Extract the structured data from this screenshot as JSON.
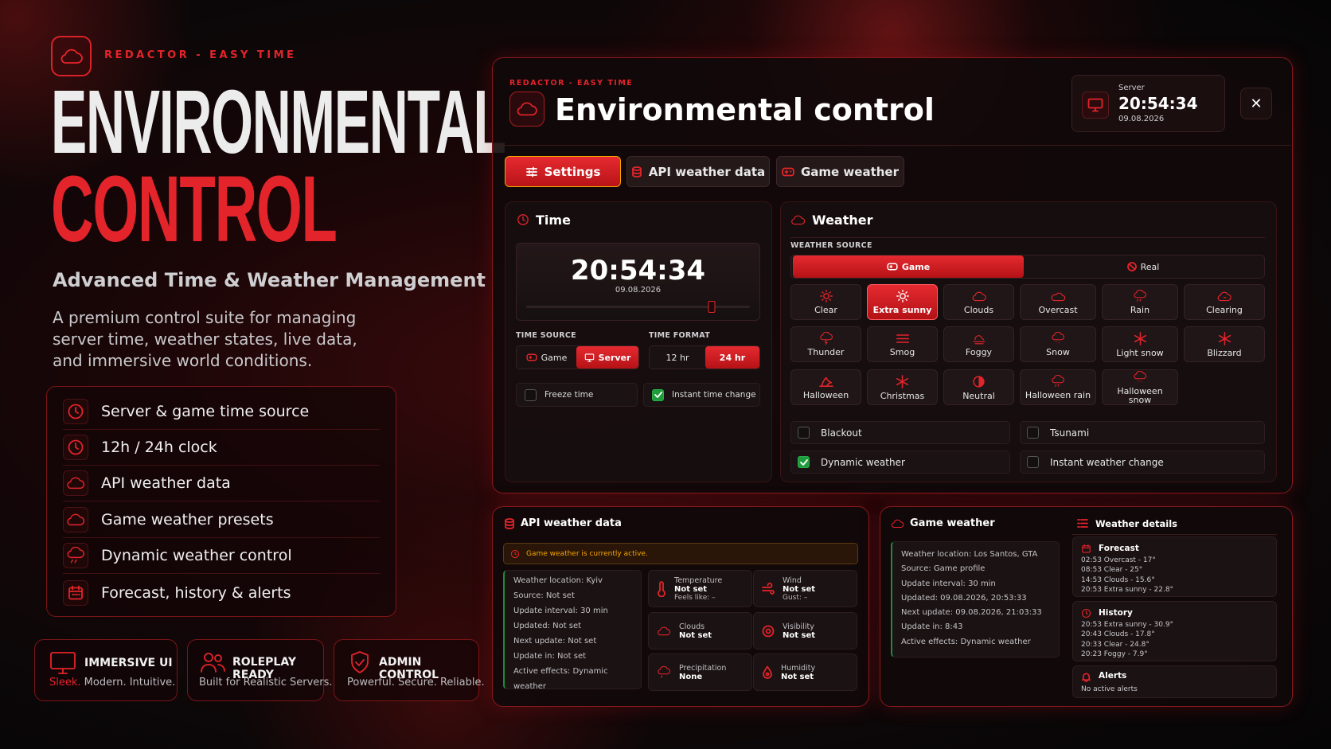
{
  "brand": {
    "tag": "REDACTOR - EASY TIME"
  },
  "hero": {
    "title_line1": "ENVIRONMENTAL",
    "title_line2": "CONTROL",
    "subtitle": "Advanced Time & Weather Management",
    "description": "A premium control suite for managing server time, weather states, live data, and immersive world conditions."
  },
  "features": [
    {
      "icon": "clock-icon",
      "label": "Server & game time source"
    },
    {
      "icon": "clock-icon",
      "label": "12h / 24h clock"
    },
    {
      "icon": "cloud-icon",
      "label": "API weather data"
    },
    {
      "icon": "cloud-icon",
      "label": "Game weather presets"
    },
    {
      "icon": "cloud-rain-icon",
      "label": "Dynamic weather control"
    },
    {
      "icon": "calendar-icon",
      "label": "Forecast, history & alerts"
    }
  ],
  "tiles": [
    {
      "title": "IMMERSIVE UI",
      "sub_accent": "Sleek.",
      "sub": "Modern. Intuitive."
    },
    {
      "title": "ROLEPLAY READY",
      "sub": "Built for Realistic Servers."
    },
    {
      "title": "ADMIN CONTROL",
      "sub": "Powerful. Secure. Reliable."
    }
  ],
  "panel": {
    "tag": "REDACTOR - EASY TIME",
    "title": "Environmental control",
    "server": {
      "label": "Server",
      "time": "20:54:34",
      "date": "09.08.2026"
    },
    "close": "✕",
    "tabs": [
      "Settings",
      "API weather data",
      "Game weather"
    ]
  },
  "time": {
    "heading": "Time",
    "clock": "20:54:34",
    "date": "09.08.2026",
    "slider_value": 0.83,
    "source_label": "TIME SOURCE",
    "source_options": [
      "Game",
      "Server"
    ],
    "source_selected": "Server",
    "format_label": "TIME FORMAT",
    "format_options": [
      "12 hr",
      "24 hr"
    ],
    "format_selected": "24 hr",
    "freeze": {
      "label": "Freeze time",
      "checked": false
    },
    "instant": {
      "label": "Instant time change",
      "checked": true
    }
  },
  "weather": {
    "heading": "Weather",
    "source_label": "WEATHER SOURCE",
    "source_options": [
      "Game",
      "Real"
    ],
    "source_selected": "Game",
    "presets": [
      "Clear",
      "Extra sunny",
      "Clouds",
      "Overcast",
      "Rain",
      "Clearing",
      "Thunder",
      "Smog",
      "Foggy",
      "Snow",
      "Light snow",
      "Blizzard",
      "Halloween",
      "Christmas",
      "Neutral",
      "Halloween rain",
      "Halloween snow"
    ],
    "selected": "Extra sunny",
    "toggles": [
      {
        "label": "Blackout",
        "checked": false
      },
      {
        "label": "Tsunami",
        "checked": false
      },
      {
        "label": "Dynamic weather",
        "checked": true
      },
      {
        "label": "Instant weather change",
        "checked": false
      }
    ]
  },
  "api": {
    "heading": "API weather data",
    "banner": "Game weather is currently active.",
    "info": [
      "Weather location: Kyiv",
      "Source: Not set",
      "Update interval: 30 min",
      "Updated: Not set",
      "Next update: Not set",
      "Update in: Not set",
      "Active effects: Dynamic weather"
    ],
    "metrics": [
      {
        "icon": "thermometer-icon",
        "label": "Temperature",
        "value": "Not set",
        "extra": "Feels like: –"
      },
      {
        "icon": "wind-icon",
        "label": "Wind",
        "value": "Not set",
        "extra": "Gust: –"
      },
      {
        "icon": "cloud-icon",
        "label": "Clouds",
        "value": "Not set",
        "extra": ""
      },
      {
        "icon": "eye-icon",
        "label": "Visibility",
        "value": "Not set",
        "extra": ""
      },
      {
        "icon": "precipitation-icon",
        "label": "Precipitation",
        "value": "None",
        "extra": ""
      },
      {
        "icon": "humidity-icon",
        "label": "Humidity",
        "value": "Not set",
        "extra": ""
      }
    ]
  },
  "game": {
    "heading": "Game weather",
    "info": [
      "Weather location: Los Santos, GTA",
      "Source: Game profile",
      "Update interval: 30 min",
      "Updated: 09.08.2026, 20:53:33",
      "Next update: 09.08.2026, 21:03:33",
      "Update in: 8:43",
      "Active effects: Dynamic weather"
    ],
    "details_heading": "Weather details",
    "forecast_heading": "Forecast",
    "forecast": [
      "02:53  Overcast - 17°",
      "08:53  Clear - 25°",
      "14:53  Clouds - 15.6°",
      "20:53  Extra sunny - 22.8°"
    ],
    "history_heading": "History",
    "history": [
      "20:53  Extra sunny - 30.9°",
      "20:43  Clouds - 17.8°",
      "20:33  Clear - 24.8°",
      "20:23  Foggy - 7.9°"
    ],
    "alerts_heading": "Alerts",
    "alerts_text": "No active alerts"
  },
  "colors": {
    "accent": "#e3242b",
    "gold": "#f4a500",
    "check_green": "#1f9b3c"
  }
}
